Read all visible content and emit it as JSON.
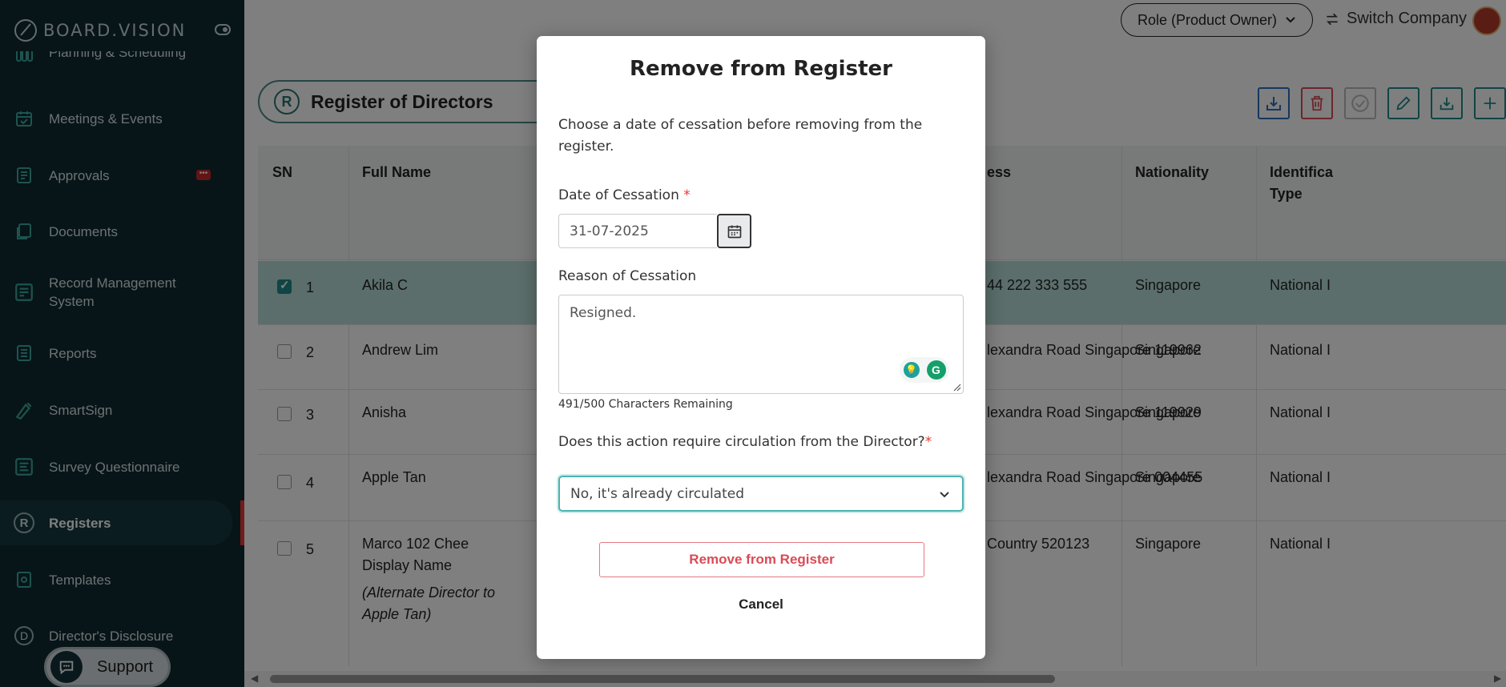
{
  "sidebar": {
    "brand": "BOARD.VISION",
    "items": [
      {
        "label": "Planning & Scheduling",
        "icon": "calendar-grid-icon"
      },
      {
        "label": "Meetings & Events",
        "icon": "calendar-check-icon"
      },
      {
        "label": "Approvals",
        "icon": "approvals-icon",
        "badge": "•••"
      },
      {
        "label": "Documents",
        "icon": "documents-icon"
      },
      {
        "label": "Record Management System",
        "icon": "record-icon"
      },
      {
        "label": "Reports",
        "icon": "reports-icon"
      },
      {
        "label": "SmartSign",
        "icon": "pen-icon"
      },
      {
        "label": "Survey Questionnaire",
        "icon": "survey-icon"
      },
      {
        "label": "Registers",
        "icon": "registers-icon",
        "active": true
      },
      {
        "label": "Templates",
        "icon": "templates-icon"
      },
      {
        "label": "Director's Disclosure",
        "icon": "disclosure-icon"
      }
    ],
    "reg_letter": "R",
    "disclosure_letter": "D",
    "support": "Support"
  },
  "topbar": {
    "role": "Role (Product Owner)",
    "switch_company": "Switch Company"
  },
  "page": {
    "letter": "R",
    "title": "Register of Directors"
  },
  "table": {
    "headers": [
      "SN",
      "Full Name",
      "ess",
      "Nationality",
      "Identifica",
      "Type"
    ],
    "rows": [
      {
        "sn": "1",
        "name": "Akila C",
        "address": "44 222 333 555",
        "nationality": "Singapore",
        "id_type": "National I",
        "checked": true
      },
      {
        "sn": "2",
        "name": "Andrew Lim",
        "address": "lexandra Road Singapore 119962",
        "nationality": "Singapore",
        "id_type": "National I",
        "checked": false
      },
      {
        "sn": "3",
        "name": "Anisha",
        "address": "lexandra Road Singapore 119929",
        "nationality": "Singapore",
        "id_type": "National I",
        "checked": false
      },
      {
        "sn": "4",
        "name": "Apple Tan",
        "address": "lexandra Road Singapore 004455",
        "nationality": "Singapore",
        "id_type": "National I",
        "checked": false
      },
      {
        "sn": "5",
        "name": "Marco 102 Chee",
        "name2": "Display Name",
        "note1": "(Alternate Director to",
        "note2": "Apple Tan)",
        "address": "Country 520123",
        "nationality": "Singapore",
        "id_type": "National I",
        "checked": false
      }
    ]
  },
  "modal": {
    "title": "Remove from Register",
    "description": "Choose a date of cessation before removing from the register.",
    "date_label": "Date of Cessation",
    "required_mark": "*",
    "date_value": "31-07-2025",
    "reason_label": "Reason of Cessation",
    "reason_value": "Resigned.",
    "chars_remaining": "491/500 Characters Remaining",
    "circulation_label": "Does this action require circulation from the Director?",
    "circulation_value": "No, it's already circulated",
    "remove_button": "Remove from Register",
    "cancel_button": "Cancel"
  },
  "colors": {
    "sidebar_bg": "#0f2a30",
    "accent": "#2a7470",
    "danger": "#d94a56",
    "selected_row": "#b6ddd6"
  }
}
